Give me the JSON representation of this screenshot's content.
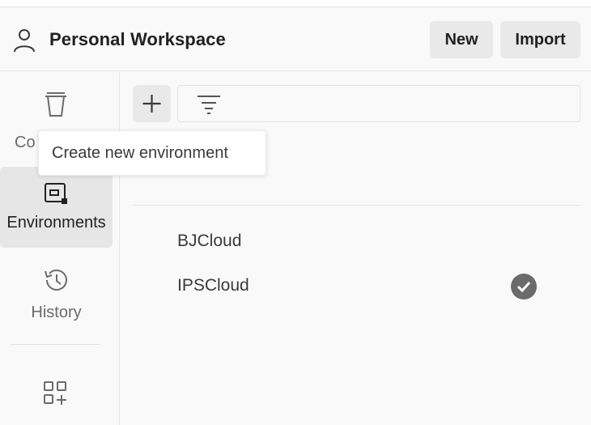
{
  "header": {
    "workspace_icon": "user-icon",
    "workspace_title": "Personal Workspace",
    "new_label": "New",
    "import_label": "Import"
  },
  "sidebar": {
    "items": [
      {
        "icon": "collections-icon",
        "label": "Co"
      },
      {
        "icon": "environments-icon",
        "label": "Environments"
      },
      {
        "icon": "history-icon",
        "label": "History"
      }
    ],
    "add_workbench_icon": "configure-workbench-icon"
  },
  "tooltip": {
    "text": "Create new environment"
  },
  "toolbar": {
    "add_icon": "plus-icon",
    "filter_icon": "filter-icon"
  },
  "environments": [
    {
      "name": "BJCloud",
      "active": false
    },
    {
      "name": "IPSCloud",
      "active": true
    }
  ],
  "colors": {
    "accent": "#6b6b6b",
    "button_bg": "#e9e9e9",
    "active_bg": "#e6e6e6"
  }
}
